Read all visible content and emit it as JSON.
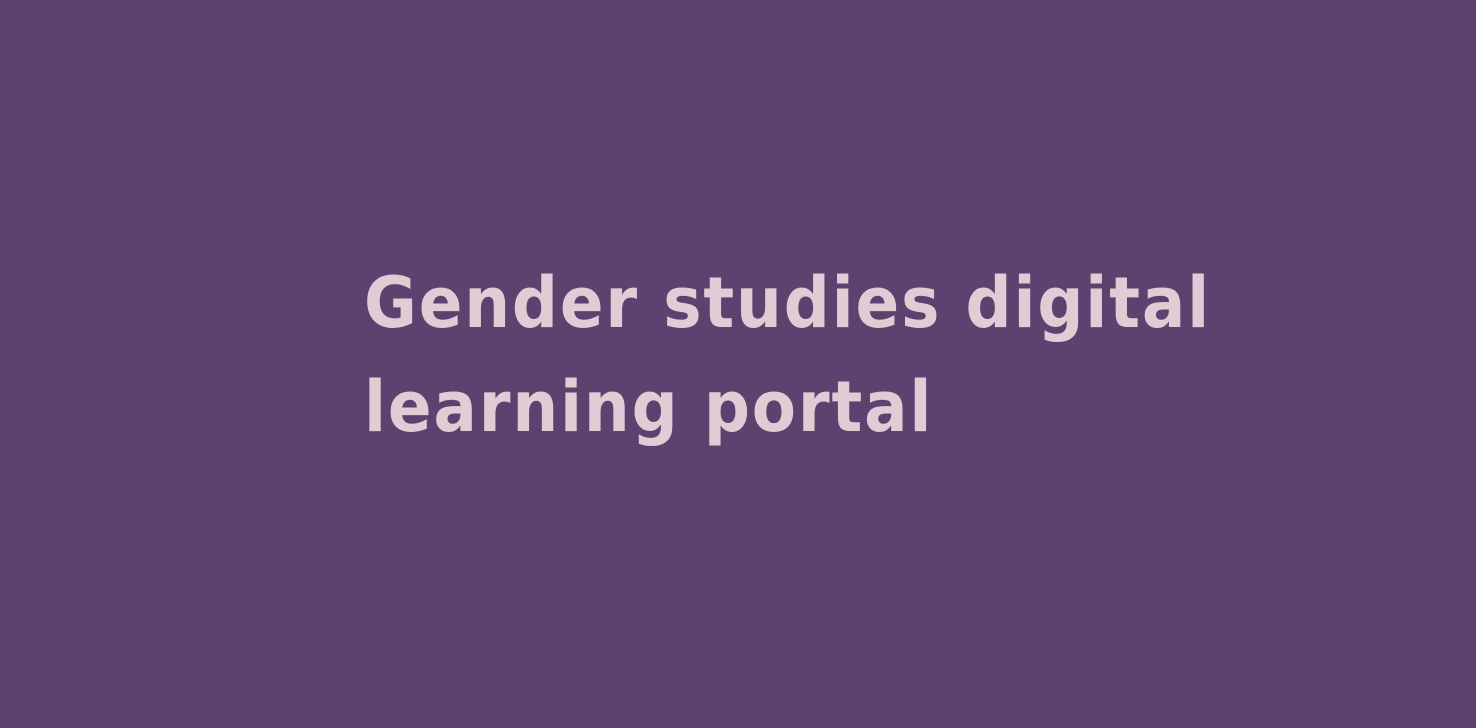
{
  "colors": {
    "background": "#5c426f",
    "title_text": "#e3cbd6"
  },
  "title": {
    "line1": "Gender studies digital",
    "line2": "learning portal"
  }
}
